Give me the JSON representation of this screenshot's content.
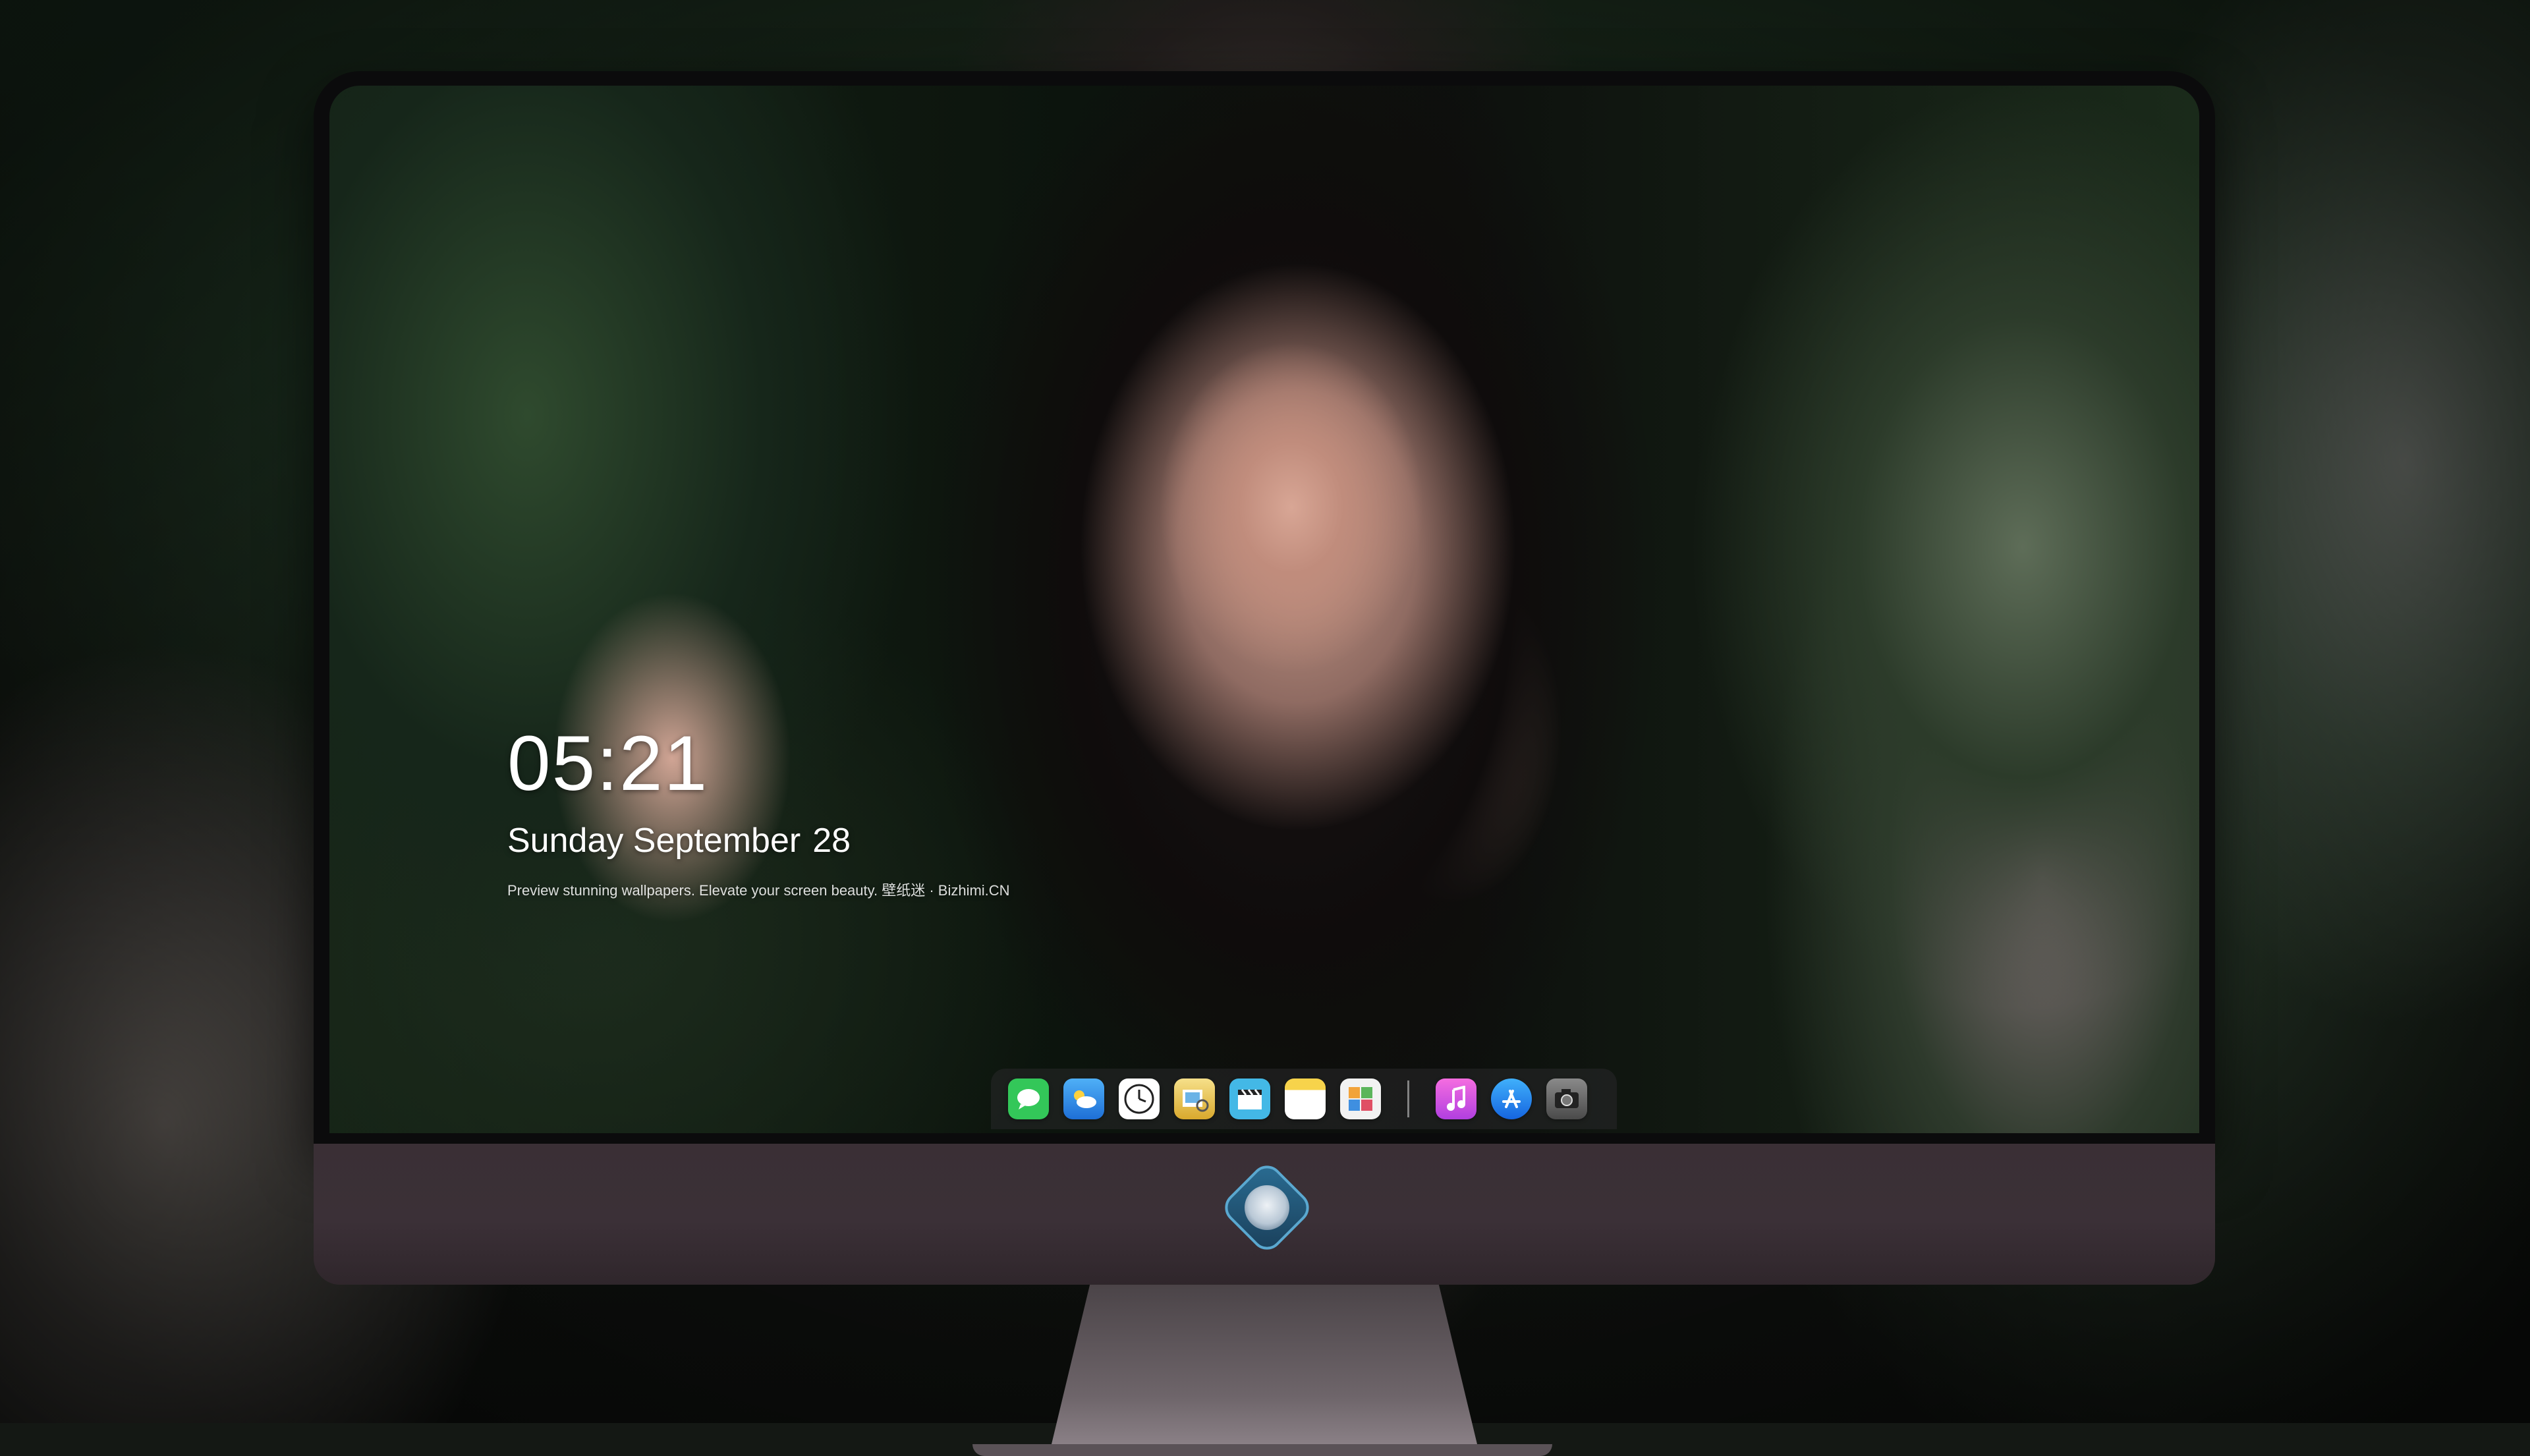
{
  "lock_screen": {
    "time": "05:21",
    "weekday_month": "Sunday September",
    "day": "28",
    "tagline": "Preview stunning wallpapers. Elevate your screen beauty. 壁纸迷 · Bizhimi.CN"
  },
  "dock": {
    "apps": [
      {
        "name": "Messages",
        "icon": "messages-icon",
        "color": "#33c759"
      },
      {
        "name": "Weather",
        "icon": "weather-icon",
        "color": "#2f8df3"
      },
      {
        "name": "Clock",
        "icon": "clock-icon",
        "color": "#ffffff"
      },
      {
        "name": "Preview",
        "icon": "preview-icon",
        "color": "#e8c64a"
      },
      {
        "name": "Clips",
        "icon": "clapperboard-icon",
        "color": "#43b8e6"
      },
      {
        "name": "Notes",
        "icon": "notes-icon",
        "color": "#f7d34b"
      },
      {
        "name": "Photos",
        "icon": "photos-icon",
        "color": "#f2f2f2"
      },
      {
        "name": "iTunes",
        "icon": "music-note-icon",
        "color": "#e24bd8"
      },
      {
        "name": "App Store",
        "icon": "app-store-icon",
        "color": "#1b8ff1"
      },
      {
        "name": "Camera",
        "icon": "camera-icon",
        "color": "#6b6b6b"
      }
    ]
  },
  "device": {
    "bezel_color": "#0b0b0c",
    "chin_color": "#3a2f35"
  }
}
